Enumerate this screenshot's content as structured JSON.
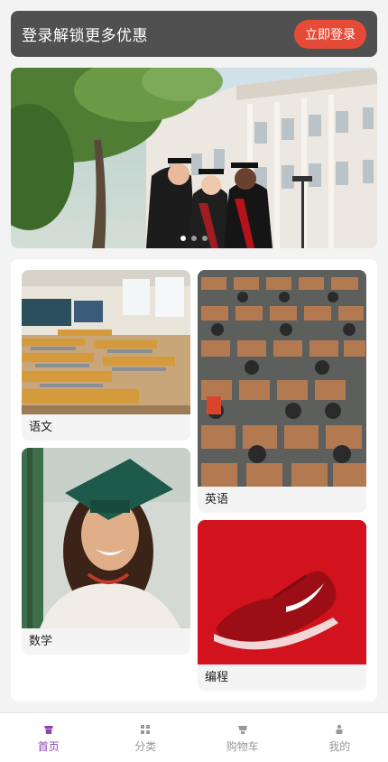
{
  "login_bar": {
    "text": "登录解锁更多优惠",
    "button_label": "立即登录",
    "button_color": "#e54b37"
  },
  "carousel": {
    "dot_count": 3,
    "active_index": 0
  },
  "categories": [
    {
      "label": "语文",
      "image": "classroom"
    },
    {
      "label": "英语",
      "image": "lecture-hall"
    },
    {
      "label": "数学",
      "image": "graduate-portrait"
    },
    {
      "label": "编程",
      "image": "red-sneaker"
    }
  ],
  "nav": {
    "active_color": "#8e44ad",
    "items": [
      {
        "label": "首页",
        "icon": "home-icon"
      },
      {
        "label": "分类",
        "icon": "grid-icon"
      },
      {
        "label": "购物车",
        "icon": "cart-icon"
      },
      {
        "label": "我的",
        "icon": "user-icon"
      }
    ]
  }
}
